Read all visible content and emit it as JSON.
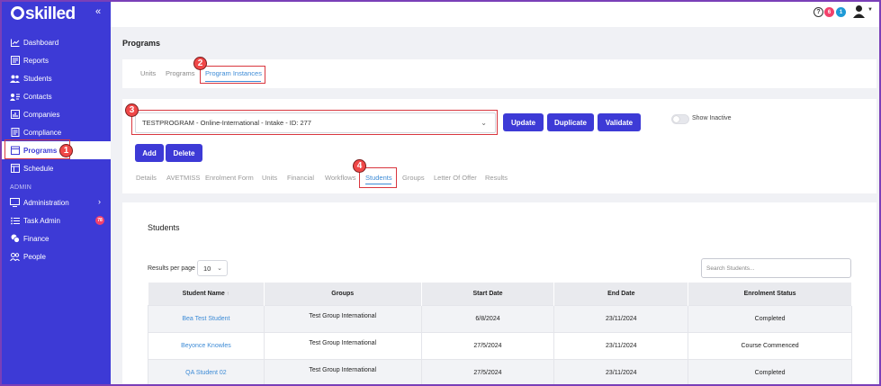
{
  "brand": {
    "logo_text": "skilled"
  },
  "sidebar": {
    "items": [
      {
        "label": "Dashboard",
        "icon": "chart-line-icon"
      },
      {
        "label": "Reports",
        "icon": "report-icon"
      },
      {
        "label": "Students",
        "icon": "users-icon"
      },
      {
        "label": "Contacts",
        "icon": "contact-card-icon"
      },
      {
        "label": "Companies",
        "icon": "bar-chart-icon"
      },
      {
        "label": "Compliance",
        "icon": "document-icon"
      },
      {
        "label": "Programs",
        "icon": "calendar-icon",
        "active": true
      },
      {
        "label": "Schedule",
        "icon": "schedule-icon"
      }
    ],
    "section_admin": "ADMIN",
    "admin_items": [
      {
        "label": "Administration",
        "icon": "monitor-icon"
      },
      {
        "label": "Task Admin",
        "icon": "list-icon",
        "badge": "78"
      },
      {
        "label": "Finance",
        "icon": "coins-icon"
      },
      {
        "label": "People",
        "icon": "people-icon"
      }
    ]
  },
  "topbar": {
    "help_label": "?",
    "badge_red": "6",
    "badge_blue": "1",
    "colors": {
      "red": "#f2416b",
      "blue": "#1e9ad6"
    }
  },
  "page": {
    "title": "Programs",
    "tabs": [
      "Units",
      "Programs",
      "Program Instances"
    ],
    "active_tab": "Program Instances"
  },
  "form": {
    "program_select_value": "TESTPROGRAM - Online-International - Intake - ID: 277",
    "buttons": {
      "update": "Update",
      "duplicate": "Duplicate",
      "validate": "Validate",
      "add": "Add",
      "delete": "Delete"
    },
    "show_inactive_label": "Show Inactive"
  },
  "subtabs": [
    "Details",
    "AVETMISS",
    "Enrolment Form",
    "Units",
    "Financial",
    "Workflows",
    "Students",
    "Groups",
    "Letter Of Offer",
    "Results"
  ],
  "students": {
    "title": "Students",
    "rpp_label": "Results per page",
    "rpp_value": "10",
    "search_placeholder": "Search Students...",
    "columns": [
      "Student Name",
      "Groups",
      "Start Date",
      "End Date",
      "Enrolment Status"
    ],
    "sort_indicator": "↑",
    "rows": [
      {
        "name": "Bea Test Student",
        "group": "Test Group International",
        "start": "6/8/2024",
        "end": "23/11/2024",
        "status": "Completed"
      },
      {
        "name": "Beyonce Knowles",
        "group": "Test Group International",
        "start": "27/5/2024",
        "end": "23/11/2024",
        "status": "Course Commenced"
      },
      {
        "name": "QA Student 02",
        "group": "Test Group International",
        "start": "27/5/2024",
        "end": "23/11/2024",
        "status": "Completed"
      }
    ]
  },
  "callouts": [
    "1",
    "2",
    "3",
    "4"
  ],
  "colors": {
    "primary": "#3d3ad6",
    "link": "#3d8bd6",
    "callout": "#d9363e"
  }
}
